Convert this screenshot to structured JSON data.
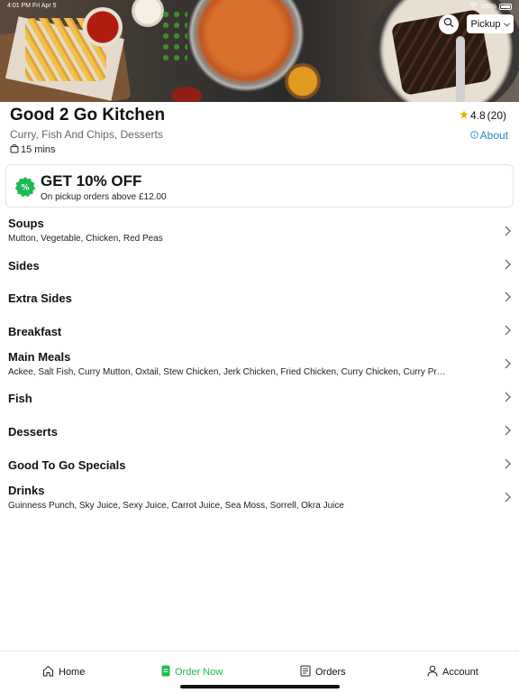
{
  "status_bar": {
    "time": "4:01 PM",
    "date": "Fri Apr 5",
    "battery": "100%"
  },
  "header": {
    "search_icon": "search-icon",
    "mode_label": "Pickup"
  },
  "restaurant": {
    "name": "Good 2 Go Kitchen",
    "cuisines": "Curry, Fish And Chips, Desserts",
    "prep_time": "15 mins",
    "rating": "4.8",
    "reviews": "(20)",
    "about_label": "About"
  },
  "offer": {
    "headline": "GET 10% OFF",
    "subtext": "On pickup orders above £12.00",
    "badge_color": "#1db954"
  },
  "menu": {
    "categories": [
      {
        "name": "Soups",
        "description": "Mutton, Vegetable, Chicken, Red Peas"
      },
      {
        "name": "Sides",
        "description": ""
      },
      {
        "name": "Extra Sides",
        "description": ""
      },
      {
        "name": "Breakfast",
        "description": ""
      },
      {
        "name": "Main Meals",
        "description": "Ackee, Salt Fish, Curry Mutton, Oxtail, Stew Chicken, Jerk Chicken, Fried Chicken, Curry Chicken, Curry Pr…"
      },
      {
        "name": "Fish",
        "description": ""
      },
      {
        "name": "Desserts",
        "description": ""
      },
      {
        "name": "Good To Go Specials",
        "description": ""
      },
      {
        "name": "Drinks",
        "description": "Guinness Punch, Sky Juice, Sexy Juice, Carrot Juice, Sea Moss, Sorrell, Okra Juice"
      }
    ]
  },
  "bottom_nav": {
    "items": [
      {
        "label": "Home",
        "icon": "home-icon",
        "active": false
      },
      {
        "label": "Order Now",
        "icon": "order-icon",
        "active": true
      },
      {
        "label": "Orders",
        "icon": "receipt-icon",
        "active": false
      },
      {
        "label": "Account",
        "icon": "user-icon",
        "active": false
      }
    ]
  },
  "colors": {
    "accent": "#1db954",
    "link": "#2a86c8",
    "star": "#f2a900"
  }
}
